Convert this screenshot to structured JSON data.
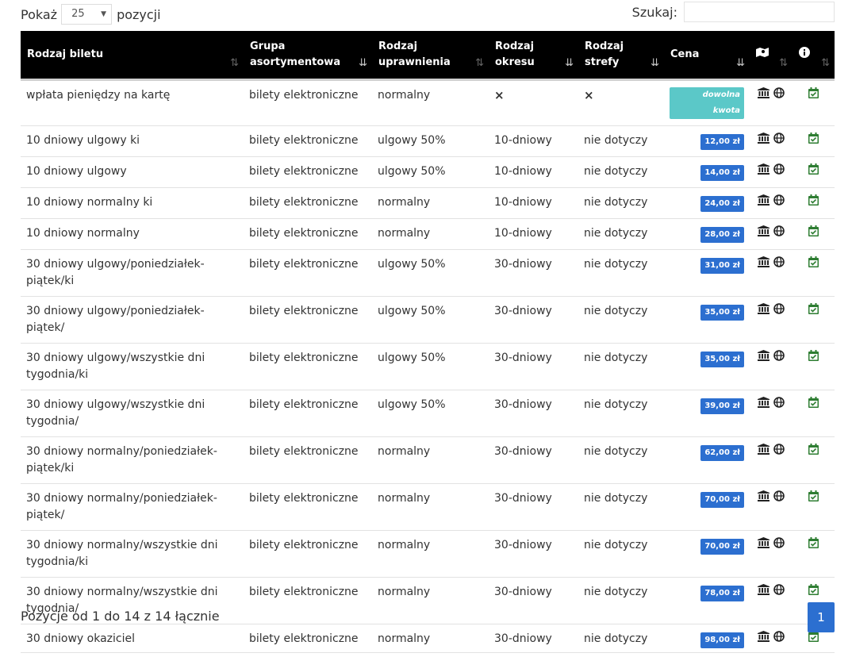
{
  "controls": {
    "show_prefix": "Pokaż",
    "show_value": "25",
    "show_suffix": "pozycji",
    "search_label": "Szukaj:",
    "search_value": ""
  },
  "columns": [
    "Rodzaj biletu",
    "Grupa asortymentowa",
    "Rodzaj uprawnienia",
    "Rodzaj okresu",
    "Rodzaj strefy",
    "Cena"
  ],
  "rows": [
    {
      "name": "wpłata pieniędzy na kartę",
      "group": "bilety elektroniczne",
      "entitlement": "normalny",
      "period": "×",
      "zone": "×",
      "price": "dowolna kwota",
      "price_type": "any"
    },
    {
      "name": "10 dniowy ulgowy ki",
      "group": "bilety elektroniczne",
      "entitlement": "ulgowy 50%",
      "period": "10-dniowy",
      "zone": "nie dotyczy",
      "price": "12,00 zł",
      "price_type": "fixed"
    },
    {
      "name": "10 dniowy ulgowy",
      "group": "bilety elektroniczne",
      "entitlement": "ulgowy 50%",
      "period": "10-dniowy",
      "zone": "nie dotyczy",
      "price": "14,00 zł",
      "price_type": "fixed"
    },
    {
      "name": "10 dniowy normalny ki",
      "group": "bilety elektroniczne",
      "entitlement": "normalny",
      "period": "10-dniowy",
      "zone": "nie dotyczy",
      "price": "24,00 zł",
      "price_type": "fixed"
    },
    {
      "name": "10 dniowy normalny",
      "group": "bilety elektroniczne",
      "entitlement": "normalny",
      "period": "10-dniowy",
      "zone": "nie dotyczy",
      "price": "28,00 zł",
      "price_type": "fixed"
    },
    {
      "name": "30 dniowy ulgowy/poniedziałek-piątek/ki",
      "group": "bilety elektroniczne",
      "entitlement": "ulgowy 50%",
      "period": "30-dniowy",
      "zone": "nie dotyczy",
      "price": "31,00 zł",
      "price_type": "fixed"
    },
    {
      "name": "30 dniowy ulgowy/poniedziałek-piątek/",
      "group": "bilety elektroniczne",
      "entitlement": "ulgowy 50%",
      "period": "30-dniowy",
      "zone": "nie dotyczy",
      "price": "35,00 zł",
      "price_type": "fixed"
    },
    {
      "name": "30 dniowy ulgowy/wszystkie dni tygodnia/ki",
      "group": "bilety elektroniczne",
      "entitlement": "ulgowy 50%",
      "period": "30-dniowy",
      "zone": "nie dotyczy",
      "price": "35,00 zł",
      "price_type": "fixed"
    },
    {
      "name": "30 dniowy ulgowy/wszystkie dni tygodnia/",
      "group": "bilety elektroniczne",
      "entitlement": "ulgowy 50%",
      "period": "30-dniowy",
      "zone": "nie dotyczy",
      "price": "39,00 zł",
      "price_type": "fixed"
    },
    {
      "name": "30 dniowy normalny/poniedziałek-piątek/ki",
      "group": "bilety elektroniczne",
      "entitlement": "normalny",
      "period": "30-dniowy",
      "zone": "nie dotyczy",
      "price": "62,00 zł",
      "price_type": "fixed"
    },
    {
      "name": "30 dniowy normalny/poniedziałek-piątek/",
      "group": "bilety elektroniczne",
      "entitlement": "normalny",
      "period": "30-dniowy",
      "zone": "nie dotyczy",
      "price": "70,00 zł",
      "price_type": "fixed"
    },
    {
      "name": "30 dniowy normalny/wszystkie dni tygodnia/ki",
      "group": "bilety elektroniczne",
      "entitlement": "normalny",
      "period": "30-dniowy",
      "zone": "nie dotyczy",
      "price": "70,00 zł",
      "price_type": "fixed"
    },
    {
      "name": "30 dniowy normalny/wszystkie dni tygodnia/",
      "group": "bilety elektroniczne",
      "entitlement": "normalny",
      "period": "30-dniowy",
      "zone": "nie dotyczy",
      "price": "78,00 zł",
      "price_type": "fixed"
    },
    {
      "name": "30 dniowy okaziciel",
      "group": "bilety elektroniczne",
      "entitlement": "normalny",
      "period": "30-dniowy",
      "zone": "nie dotyczy",
      "price": "98,00 zł",
      "price_type": "fixed"
    }
  ],
  "footer": {
    "info": "Pozycje od 1 do 14 z 14 łącznie",
    "page": "1"
  },
  "colors": {
    "header_bg": "#000000",
    "price_badge": "#2c6fd0",
    "any_badge": "#5bc8c8",
    "calendar_icon": "#2e7d32",
    "pagination": "#2c6fd0"
  },
  "icons": {
    "row_icons": [
      "bank-icon",
      "globe-icon",
      "calendar-check-icon"
    ],
    "header_icons": [
      "map-icon",
      "info-icon"
    ]
  }
}
